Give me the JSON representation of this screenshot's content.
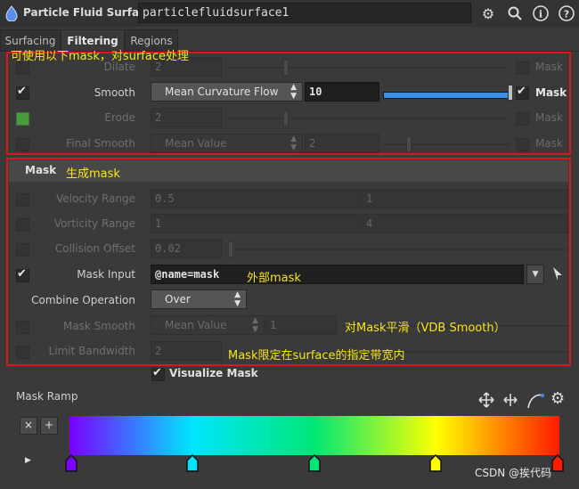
{
  "header": {
    "node_type": "Particle Fluid Surface",
    "node_name": "particlefluidsurface1",
    "icons": [
      "gear-icon",
      "search-icon",
      "info-icon",
      "help-icon"
    ]
  },
  "tabs": [
    {
      "label": "Surfacing",
      "active": false
    },
    {
      "label": "Filtering",
      "active": true
    },
    {
      "label": "Regions",
      "active": false
    }
  ],
  "filter": {
    "dilate": {
      "label": "Dilate",
      "value": "2",
      "mask_label": "Mask",
      "enabled": false
    },
    "smooth": {
      "label": "Smooth",
      "method": "Mean Curvature Flow",
      "value": "10",
      "mask_label": "Mask",
      "enabled": true,
      "mask_checked": true,
      "slider_fraction": 1.0
    },
    "erode": {
      "label": "Erode",
      "value": "2",
      "mask_label": "Mask",
      "enabled": false
    },
    "final_smooth": {
      "label": "Final Smooth",
      "method": "Mean Value",
      "value": "2",
      "mask_label": "Mask",
      "enabled": false
    }
  },
  "mask_section": {
    "title": "Mask",
    "velocity_range": {
      "label": "Velocity Range",
      "min": "0.5",
      "max": "1"
    },
    "vorticity_range": {
      "label": "Vorticity Range",
      "min": "1",
      "max": "4"
    },
    "collision_offset": {
      "label": "Collision Offset",
      "value": "0.02"
    },
    "mask_input": {
      "label": "Mask Input",
      "value": "@name=mask"
    },
    "combine_operation": {
      "label": "Combine Operation",
      "value": "Over"
    },
    "mask_smooth": {
      "label": "Mask Smooth",
      "method": "Mean Value",
      "value": "1"
    },
    "limit_bandwidth": {
      "label": "Limit Bandwidth",
      "value": "2"
    },
    "visualize_mask": "Visualize Mask"
  },
  "ramp": {
    "label": "Mask Ramp",
    "remove_label": "×",
    "add_label": "+",
    "key_colors": [
      "#7a00ff",
      "#00e5ff",
      "#00e676",
      "#ffff00",
      "#ff1a00"
    ]
  },
  "annotations": {
    "filter_note": "可使用以下mask，对surface处理",
    "mask_note": "生成mask",
    "mask_input_note": "外部mask",
    "mask_smooth_note": "对Mask平滑（VDB Smooth）",
    "bandwidth_note": "Mask限定在surface的指定带宽内"
  },
  "watermark": "CSDN @挨代码",
  "colors": {
    "highlight_red": "#e0151b",
    "annotation_yellow": "#f5e51b",
    "slider_blue": "#3a8ee6"
  }
}
